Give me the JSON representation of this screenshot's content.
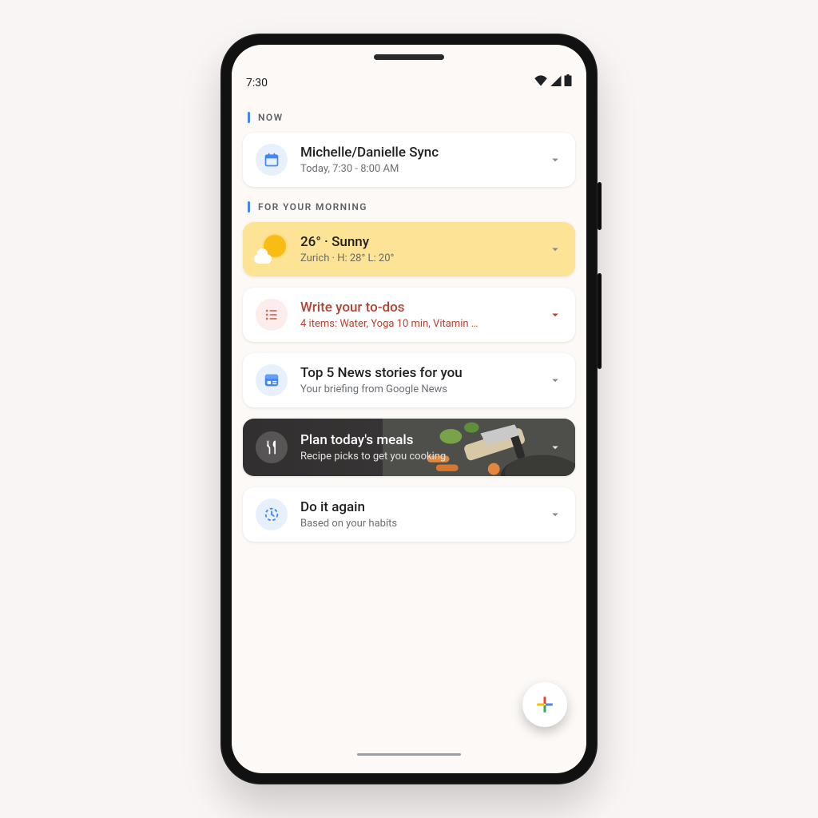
{
  "status": {
    "time": "7:30"
  },
  "sections": {
    "now": {
      "label": "NOW"
    },
    "morning": {
      "label": "FOR YOUR MORNING"
    }
  },
  "cards": {
    "event": {
      "title": "Michelle/Danielle Sync",
      "sub": "Today, 7:30 - 8:00 AM"
    },
    "weather": {
      "title": "26° · Sunny",
      "sub": "Zurich · H: 28°  L: 20°"
    },
    "todo": {
      "title": "Write your to-dos",
      "sub": "4 items: Water, Yoga 10 min, Vitamin …"
    },
    "news": {
      "title": "Top 5 News stories for you",
      "sub": "Your briefing from Google News"
    },
    "meals": {
      "title": "Plan today's meals",
      "sub": "Recipe picks to get you cooking"
    },
    "again": {
      "title": "Do it again",
      "sub": "Based on your habits"
    }
  },
  "colors": {
    "accent": "#4285f4",
    "weather_card": "#fde396",
    "todo_text": "#b54333",
    "meals_card": "#302e2e"
  }
}
